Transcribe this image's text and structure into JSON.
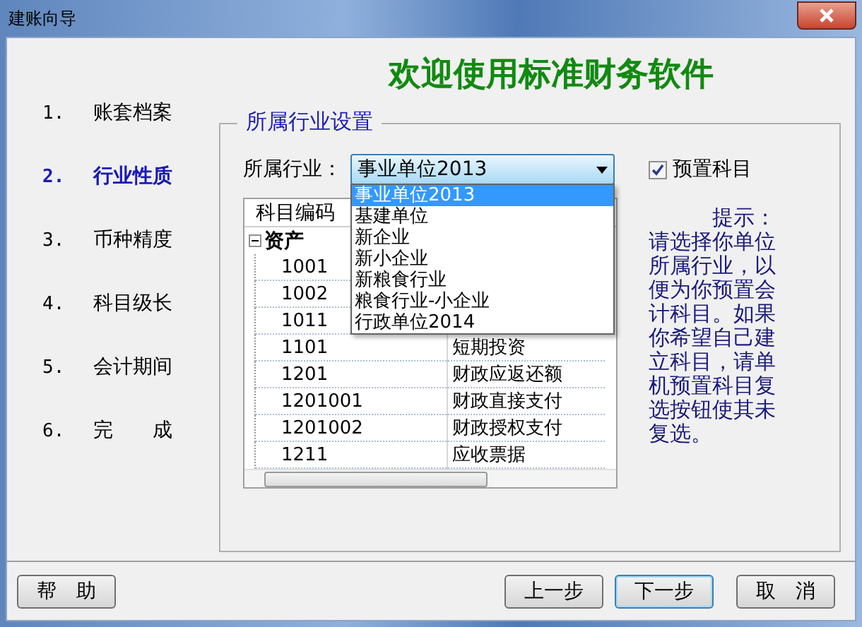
{
  "window": {
    "title": "建账向导"
  },
  "heading": "欢迎使用标准财务软件",
  "steps": [
    {
      "number": "1.",
      "label": "账套档案",
      "selected": false
    },
    {
      "number": "2.",
      "label": "行业性质",
      "selected": true
    },
    {
      "number": "3.",
      "label": "币种精度",
      "selected": false
    },
    {
      "number": "4.",
      "label": "科目级长",
      "selected": false
    },
    {
      "number": "5.",
      "label": "会计期间",
      "selected": false
    },
    {
      "number": "6.",
      "label": "完　　成",
      "selected": false
    }
  ],
  "group": {
    "title": "所属行业设置",
    "industry": {
      "label": "所属行业：",
      "value": "事业单位2013",
      "expanded": true,
      "options": [
        {
          "label": "事业单位2013",
          "selected": true
        },
        {
          "label": "基建单位",
          "selected": false
        },
        {
          "label": "新企业",
          "selected": false
        },
        {
          "label": "新小企业",
          "selected": false
        },
        {
          "label": "新粮食行业",
          "selected": false
        },
        {
          "label": "粮食行业-小企业",
          "selected": false
        },
        {
          "label": "行政单位2014",
          "selected": false
        }
      ]
    },
    "preset": {
      "label": "预置科目",
      "checked": true
    },
    "accounts": {
      "columns": [
        "科目编码"
      ],
      "rows": [
        {
          "code": "资产",
          "expanded": true,
          "children": [
            {
              "code": "1001"
            },
            {
              "code": "1002"
            },
            {
              "code": "1011"
            },
            {
              "code": "1101",
              "name": "短期投资"
            },
            {
              "code": "1201",
              "name": "财政应返还额"
            },
            {
              "code": "1201001",
              "name": "财政直接支付"
            },
            {
              "code": "1201002",
              "name": "财政授权支付"
            },
            {
              "code": "1211",
              "name": "应收票据"
            }
          ]
        }
      ]
    },
    "hint": "提示：请选择你单位所属行业，以便为你预置会计科目。如果你希望自己建立科目，请单机预置科目复选按钮使其未复选。"
  },
  "buttons": [
    {
      "label": "帮　助",
      "focused": false
    },
    {
      "label": "上一步",
      "focused": false
    },
    {
      "label": "下一步",
      "focused": true
    },
    {
      "label": "取　消",
      "focused": false
    }
  ]
}
